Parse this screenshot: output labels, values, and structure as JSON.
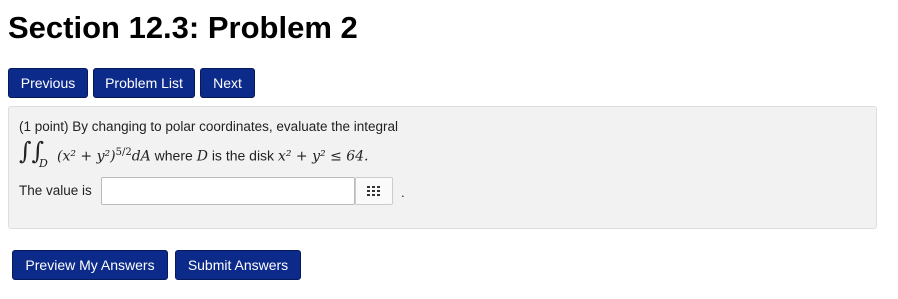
{
  "page": {
    "title": "Section 12.3: Problem 2"
  },
  "nav": {
    "previous": "Previous",
    "problem_list": "Problem List",
    "next": "Next"
  },
  "problem": {
    "points": "(1 point)",
    "intro": "By changing to polar coordinates, evaluate the integral",
    "where_text": "where",
    "disk_text": "is the disk",
    "D": "D",
    "integrand_base": "(x² + y²)",
    "integrand_exp": "5/2",
    "dA": "dA",
    "region": "x² + y² ≤ 64.",
    "answer_label": "The value is",
    "answer_value": "",
    "answer_suffix": "."
  },
  "actions": {
    "preview": "Preview My Answers",
    "submit": "Submit Answers"
  },
  "colors": {
    "button_bg": "#0b2a8a",
    "panel_bg": "#f2f2f2"
  },
  "icons": {
    "math_toolbar": "grid-icon"
  }
}
